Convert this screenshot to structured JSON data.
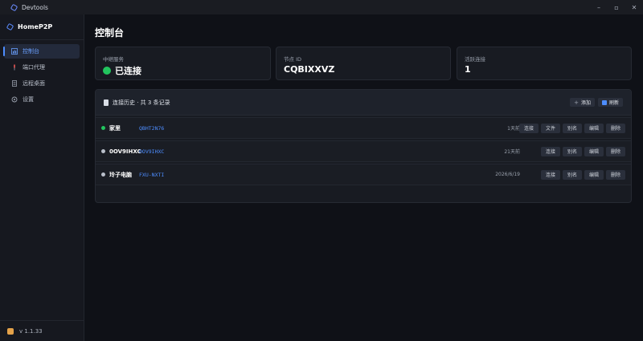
{
  "window": {
    "title": "Devtools",
    "controls": [
      "–",
      "▫",
      "✕"
    ]
  },
  "sidebar": {
    "brand": "HomeP2P",
    "items": [
      {
        "label": "控制台",
        "icon": "dashboard-icon",
        "active": true
      },
      {
        "label": "端口代理",
        "icon": "plug-icon",
        "active": false
      },
      {
        "label": "远程桌面",
        "icon": "desktop-icon",
        "active": false
      },
      {
        "label": "设置",
        "icon": "gear-icon",
        "active": false
      }
    ],
    "version": "v  1.1.33"
  },
  "main": {
    "title": "控制台",
    "stats": [
      {
        "label": "中继服务",
        "value": "已连接"
      },
      {
        "label": "节点 ID",
        "value": "CQBIXXVZ"
      },
      {
        "label": "活跃连接",
        "value": "1"
      }
    ],
    "history": {
      "title": "连接历史 · 共 3 条记录",
      "add_label": "添加",
      "refresh_label": "刷新",
      "rows": [
        {
          "name": "家里",
          "id": "QBHT2N76",
          "time": "1天前",
          "actions": [
            "连接",
            "文件",
            "别名",
            "编辑",
            "删除"
          ],
          "online": true
        },
        {
          "name": "0OV9IHXC",
          "id": "0OV9IHXC",
          "time": "21天前",
          "actions": [
            "连接",
            "别名",
            "编辑",
            "删除"
          ],
          "online": false
        },
        {
          "name": "玲子电脑",
          "id": "FXU-NXTI",
          "time": "2026/6/19",
          "actions": [
            "连接",
            "别名",
            "编辑",
            "删除"
          ],
          "online": false
        }
      ]
    }
  },
  "colors": {
    "accent": "#4d8dff",
    "online": "#22c55e",
    "offline": "#b9bfca",
    "background": "#0f1117"
  }
}
